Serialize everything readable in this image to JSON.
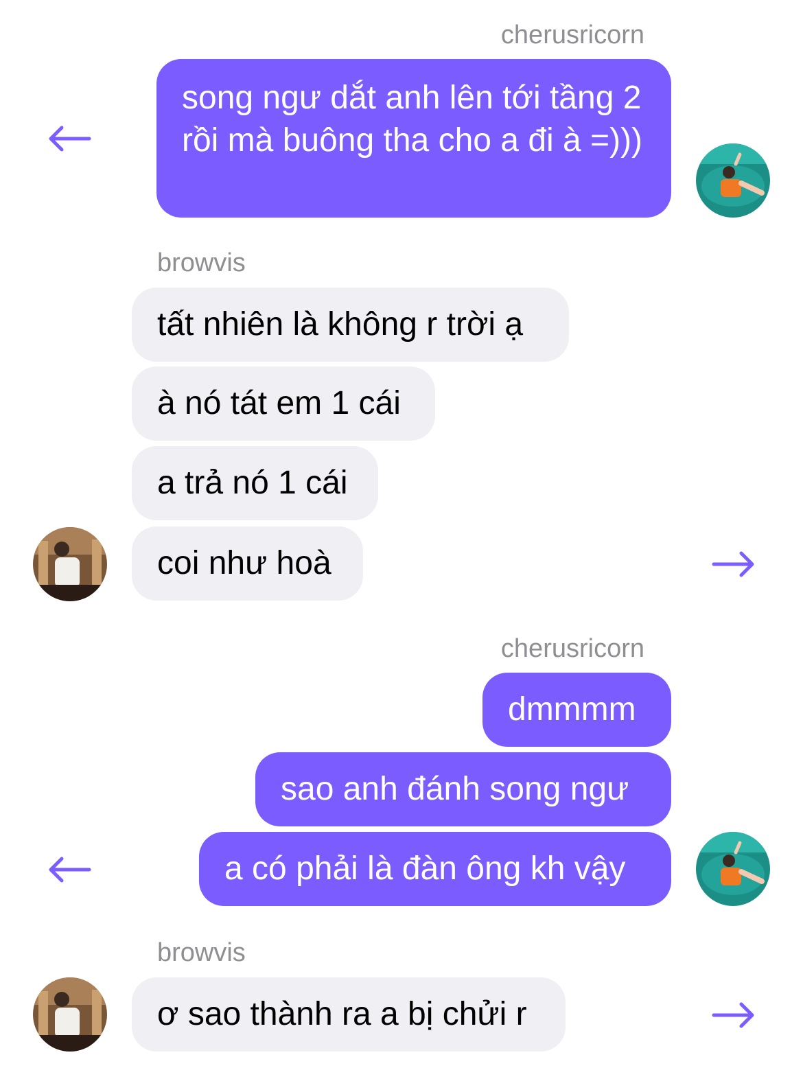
{
  "colors": {
    "accent": "#7b5cff",
    "incoming_bubble": "#efeff4",
    "sender_label": "#8e8e93"
  },
  "messages": {
    "group1_sender": "cherusricorn",
    "group1_msg1": "song ngư dắt anh lên tới tầng 2 rồi mà buông tha cho a đi à =)))",
    "group2_sender": "browvis",
    "group2_msg1": "tất nhiên là không r trời ạ",
    "group2_msg2": "à nó tát em 1 cái",
    "group2_msg3": "a trả nó 1 cái",
    "group2_msg4": "coi như hoà",
    "group3_sender": "cherusricorn",
    "group3_msg1": "dmmmm",
    "group3_msg2": "sao anh đánh song ngư",
    "group3_msg3": "a có phải là đàn ông kh vậy",
    "group4_sender": "browvis",
    "group4_msg1": "ơ sao thành ra a bị chửi r"
  },
  "icons": {
    "reply_left": "arrow-left-icon",
    "forward_right": "arrow-right-icon",
    "avatar_me": "avatar-sea-photo",
    "avatar_them": "avatar-portrait-photo"
  }
}
